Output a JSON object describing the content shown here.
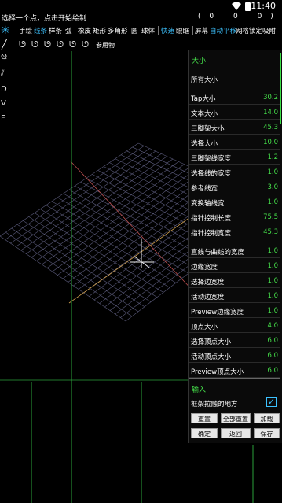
{
  "status": {
    "time": "11:40"
  },
  "info": {
    "prompt": "选择一个点，点击开始绘制",
    "coords": [
      "(",
      "0",
      "0",
      "0",
      ")"
    ]
  },
  "toolbar1": {
    "items": [
      "手绘",
      "线条",
      "样条",
      "弧",
      "橡皮",
      "矩形",
      "多角形",
      "圆",
      "球体",
      "快速",
      "眼眶",
      "屏幕",
      "自动平移",
      "网格锁定",
      "吸附"
    ]
  },
  "toolbar2": {
    "reference_label": "参用物"
  },
  "sidetools": [
    "D",
    "V",
    "F"
  ],
  "panel": {
    "section1": "大小",
    "all_sizes": "所有大小",
    "rows1": [
      {
        "label": "Tap大小",
        "value": "30.2"
      },
      {
        "label": "文本大小",
        "value": "14.0"
      },
      {
        "label": "三脚架大小",
        "value": "45.3"
      },
      {
        "label": "选择大小",
        "value": "10.0"
      },
      {
        "label": "三脚架线宽度",
        "value": "1.2"
      },
      {
        "label": "选择线的宽度",
        "value": "1.0"
      },
      {
        "label": "参考线宽",
        "value": "3.0"
      },
      {
        "label": "变换轴线宽",
        "value": "1.0"
      },
      {
        "label": "指针控制长度",
        "value": "75.5"
      },
      {
        "label": "指针控制宽度",
        "value": "45.3"
      }
    ],
    "rows2": [
      {
        "label": "直线与曲线的宽度",
        "value": "1.0"
      },
      {
        "label": "边缘宽度",
        "value": "1.0"
      },
      {
        "label": "选择边宽度",
        "value": "1.0"
      },
      {
        "label": "活动边宽度",
        "value": "1.0"
      },
      {
        "label": "Preview边缘宽度",
        "value": "1.0"
      },
      {
        "label": "顶点大小",
        "value": "4.0"
      },
      {
        "label": "选择顶点大小",
        "value": "6.0"
      },
      {
        "label": "活动顶点大小",
        "value": "6.0"
      },
      {
        "label": "Preview顶点大小",
        "value": "6.0"
      }
    ],
    "section2": "输入",
    "frame_label": "框架拉融的地方",
    "frame_checked": "✓",
    "buttons": [
      "重置",
      "全部重置",
      "加载",
      "确定",
      "返回",
      "保存"
    ]
  }
}
